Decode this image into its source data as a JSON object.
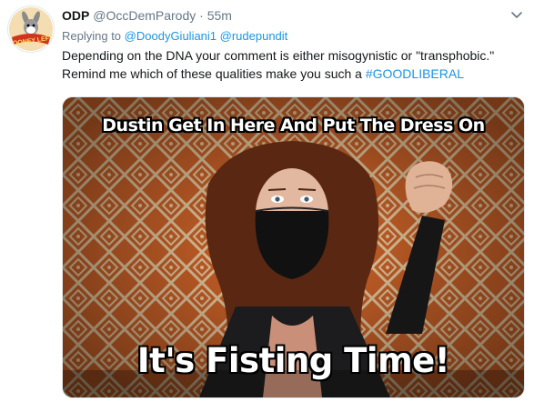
{
  "tweet": {
    "author_name": "ODP",
    "author_handle": "@OccDemParody",
    "separator": "·",
    "time": "55m",
    "replying_label": "Replying to",
    "reply_to_1": "@DoodyGiuliani1",
    "reply_to_2": "@rudepundit",
    "text": "Depending on the DNA your comment is either misogynistic or \"transphobic.\" Remind me which of these qualities make you such a",
    "hashtag": "#GOODLIBERAL"
  },
  "avatar": {
    "logo_text": "LOONEY LEFT"
  },
  "media": {
    "top_caption": "Dustin Get In Here And Put The Dress On",
    "bottom_caption": "It's Fisting Time!"
  },
  "icons": {
    "menu": "chevron-down-icon"
  },
  "colors": {
    "link": "#1b95e0",
    "muted": "#657786",
    "pattern_orange": "#d4662a",
    "pattern_light": "#f0d2a6"
  }
}
